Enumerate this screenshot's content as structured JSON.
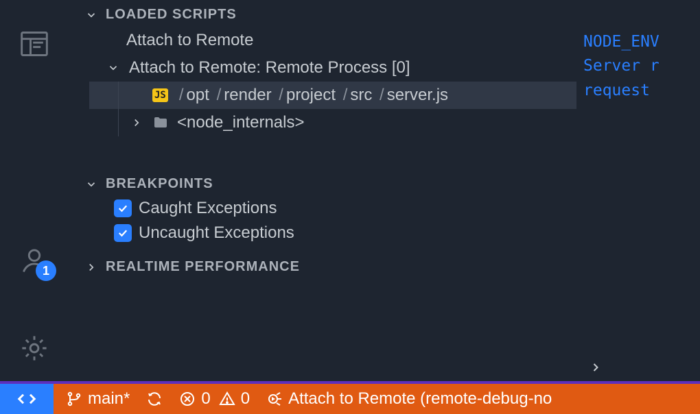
{
  "sections": {
    "loadedScripts": {
      "title": "LOADED SCRIPTS",
      "items": {
        "attach": "Attach to Remote",
        "attachProcess": "Attach to Remote: Remote Process [0]",
        "server": {
          "segments": [
            "opt",
            "render",
            "project",
            "src",
            "server.js"
          ]
        },
        "nodeInternals": "<node_internals>"
      }
    },
    "breakpoints": {
      "title": "BREAKPOINTS",
      "caught": "Caught Exceptions",
      "uncaught": "Uncaught Exceptions"
    },
    "realtime": {
      "title": "REALTIME PERFORMANCE"
    }
  },
  "terminal": {
    "line1": "NODE_ENV",
    "line2": "Server r",
    "line3": "request"
  },
  "statusbar": {
    "branch": "main*",
    "errors": "0",
    "warnings": "0",
    "debugTarget": "Attach to Remote (remote-debug-no"
  },
  "account": {
    "badge": "1"
  }
}
